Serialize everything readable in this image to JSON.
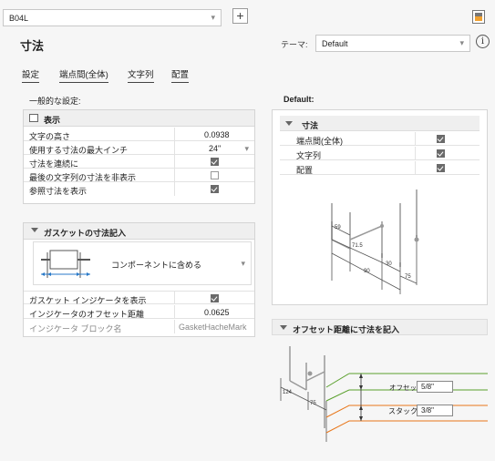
{
  "top": {
    "document_select": "B04L",
    "add_button": "+",
    "page_title": "寸法",
    "theme_label": "テーマ:",
    "theme_value": "Default",
    "info": "i"
  },
  "tabs": [
    {
      "label": "設定"
    },
    {
      "label": "端点間(全体)"
    },
    {
      "label": "文字列"
    },
    {
      "label": "配置"
    }
  ],
  "left": {
    "general_label": "一般的な設定:",
    "display": {
      "title": "表示",
      "rows": [
        {
          "label": "文字の高さ",
          "value": "0.0938"
        },
        {
          "label": "使用する寸法の最大インチ",
          "value": "24\""
        },
        {
          "label": "寸法を連続に",
          "checked": true
        },
        {
          "label": "最後の文字列の寸法を非表示",
          "checked": false
        },
        {
          "label": "参照寸法を表示",
          "checked": true
        }
      ]
    },
    "gasket": {
      "title": "ガスケットの寸法記入",
      "mode": "コンポーネントに含める",
      "rows": [
        {
          "label": "ガスケット インジケータを表示",
          "checked": true
        },
        {
          "label": "インジケータのオフセット距離",
          "value": "0.0625"
        },
        {
          "label": "インジケータ ブロック名",
          "value": "GasketHacheMark"
        }
      ]
    }
  },
  "right": {
    "default_label": "Default:",
    "dimension": {
      "title": "寸法",
      "rows": [
        {
          "label": "端点間(全体)",
          "checked": true
        },
        {
          "label": "文字列",
          "checked": true
        },
        {
          "label": "配置",
          "checked": true
        }
      ],
      "diagram_labels": [
        "59",
        "71.5",
        "30",
        "90",
        "75"
      ]
    },
    "offset": {
      "title": "オフセット距離に寸法を記入",
      "offset_label": "オフセット:",
      "offset_value": "5/8\"",
      "stack_label": "スタック:",
      "stack_value": "3/8\"",
      "diagram_labels": [
        "124",
        "75"
      ],
      "colors": {
        "offset": "#5aa02c",
        "stack": "#e8761a"
      }
    }
  }
}
